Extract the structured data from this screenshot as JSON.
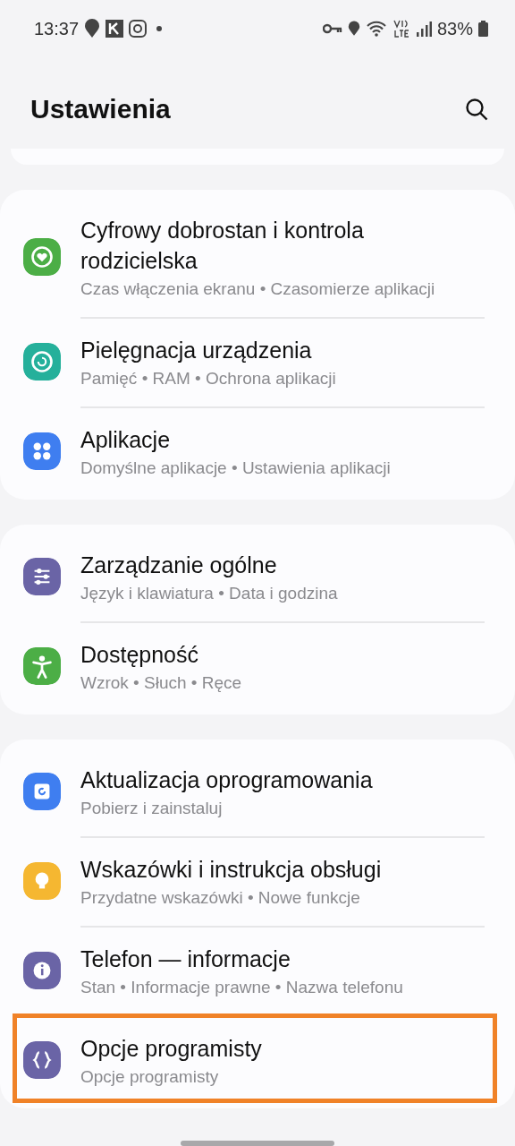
{
  "status_bar": {
    "time": "13:37",
    "battery": "83%"
  },
  "header": {
    "title": "Ustawienia"
  },
  "groups": [
    {
      "items": [
        {
          "title": "Cyfrowy dobrostan i kontrola rodzicielska",
          "subtitle": "Czas włączenia ekranu • Czasomierze aplikacji",
          "color": "#4cae46",
          "highlighted": false
        },
        {
          "title": "Pielęgnacja urządzenia",
          "subtitle": "Pamięć • RAM • Ochrona aplikacji",
          "color": "#25b09b",
          "highlighted": false
        },
        {
          "title": "Aplikacje",
          "subtitle": "Domyślne aplikacje • Ustawienia aplikacji",
          "color": "#3f7ef0",
          "highlighted": false
        }
      ]
    },
    {
      "items": [
        {
          "title": "Zarządzanie ogólne",
          "subtitle": "Język i klawiatura • Data i godzina",
          "color": "#6a64a6",
          "highlighted": false
        },
        {
          "title": "Dostępność",
          "subtitle": "Wzrok • Słuch • Ręce",
          "color": "#4cae46",
          "highlighted": false
        }
      ]
    },
    {
      "items": [
        {
          "title": "Aktualizacja oprogramowania",
          "subtitle": "Pobierz i zainstaluj",
          "color": "#3f7ef0",
          "highlighted": false
        },
        {
          "title": "Wskazówki i instrukcja obsługi",
          "subtitle": "Przydatne wskazówki • Nowe funkcje",
          "color": "#f5b731",
          "highlighted": false
        },
        {
          "title": "Telefon — informacje",
          "subtitle": "Stan • Informacje prawne • Nazwa telefonu",
          "color": "#6a64a6",
          "highlighted": false
        },
        {
          "title": "Opcje programisty",
          "subtitle": "Opcje programisty",
          "color": "#6a64a6",
          "highlighted": true
        }
      ]
    }
  ]
}
